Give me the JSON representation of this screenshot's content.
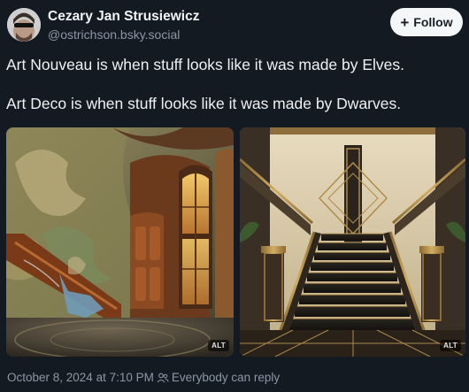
{
  "author": {
    "display_name": "Cezary Jan Strusiewicz",
    "handle": "@ostrichson.bsky.social",
    "avatar_icon": "avatar-with-sunglasses"
  },
  "actions": {
    "follow_label": "Follow",
    "follow_icon": "plus-icon"
  },
  "post": {
    "paragraphs": [
      "Art Nouveau is when stuff looks like it was made by Elves.",
      "Art Deco is when stuff looks like it was made by Dwarves."
    ],
    "images": [
      {
        "alt_badge": "ALT"
      },
      {
        "alt_badge": "ALT"
      }
    ]
  },
  "meta": {
    "timestamp": "October 8, 2024 at 7:10 PM",
    "reply_setting": "Everybody can reply",
    "reply_icon": "people-icon"
  },
  "colors": {
    "background": "#141a22",
    "secondary_text": "#8c97a6",
    "follow_button": "#f4f6f8"
  }
}
